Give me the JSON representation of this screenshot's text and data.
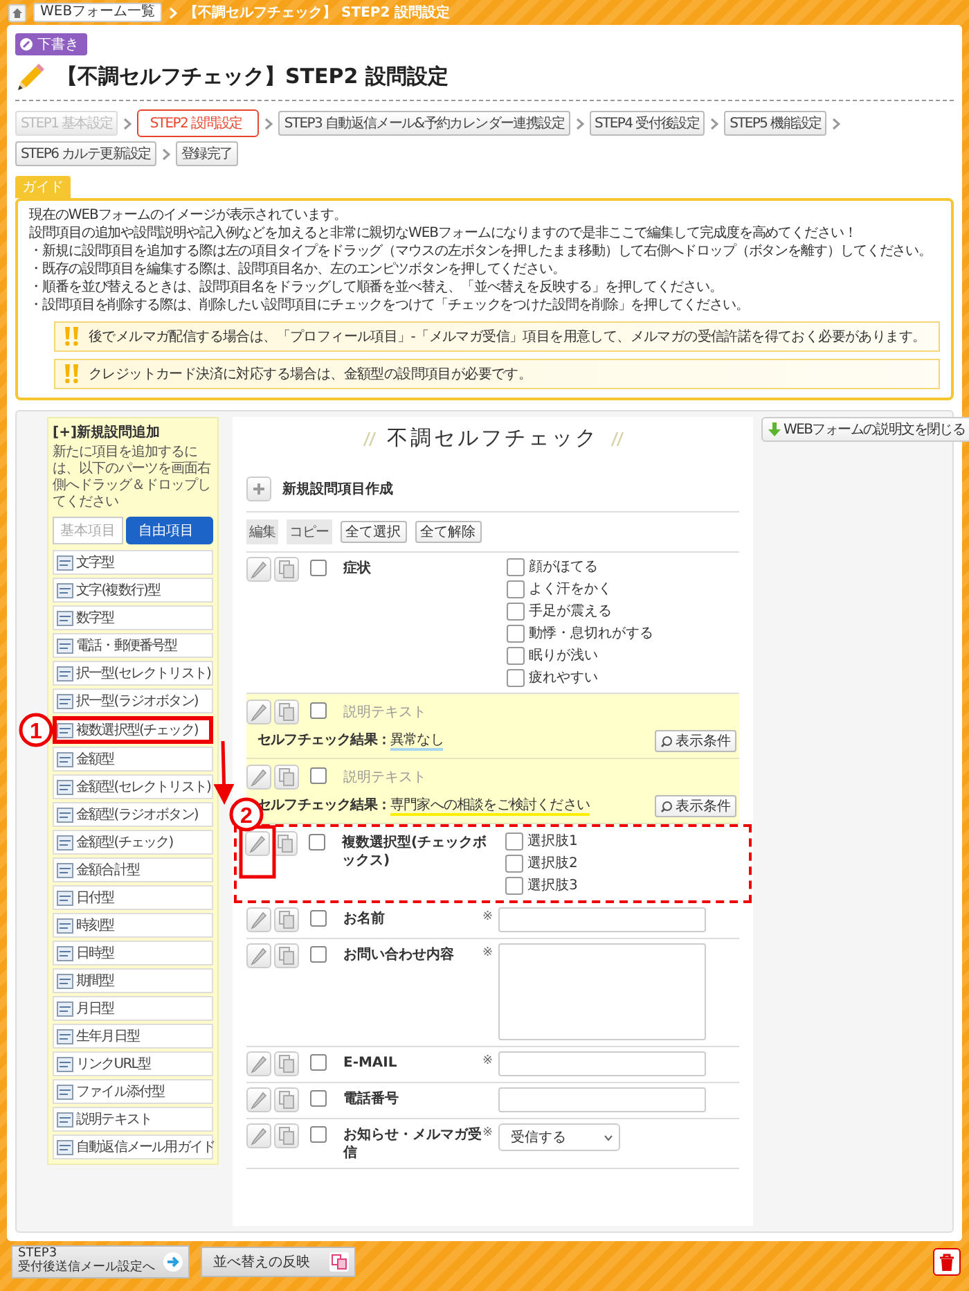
{
  "top_bar": {
    "breadcrumb": "WEBフォーム一覧",
    "title": "【不調セルフチェック】 STEP2 設問設定"
  },
  "status_badge": "下書き",
  "page_title": "【不調セルフチェック】STEP2 設問設定",
  "steps": [
    {
      "label": "STEP1 基本設定",
      "selected": false,
      "disabled": true
    },
    {
      "label": "STEP2 設問設定",
      "selected": true,
      "disabled": false
    },
    {
      "label": "STEP3 自動返信メール&予約カレンダー連携設定",
      "selected": false,
      "disabled": false
    },
    {
      "label": "STEP4 受付後設定",
      "selected": false,
      "disabled": false
    },
    {
      "label": "STEP5 機能設定",
      "selected": false,
      "disabled": false
    },
    {
      "label": "STEP6 カルテ更新設定",
      "selected": false,
      "disabled": false
    },
    {
      "label": "登録完了",
      "selected": false,
      "disabled": false
    }
  ],
  "guide": {
    "label": "ガイド",
    "lines": [
      "現在のWEBフォームのイメージが表示されています。",
      "設問項目の追加や設問説明や記入例などを加えると非常に親切なWEBフォームになりますので是非ここで編集して完成度を高めてください！",
      "・新規に設問項目を追加する際は左の項目タイプをドラッグ（マウスの左ボタンを押したまま移動）して右側へドロップ（ボタンを離す）してください。",
      "・既存の設問項目を編集する際は、設問項目名か、左のエンピツボタンを押してください。",
      "・順番を並び替えるときは、設問項目名をドラッグして順番を並べ替え、「並べ替えを反映する」を押してください。",
      "・設問項目を削除する際は、削除したい設問項目にチェックをつけて「チェックをつけた設問を削除」を押してください。"
    ],
    "notes": [
      "後でメルマガ配信する場合は、「プロフィール項目」-「メルマガ受信」項目を用意して、メルマガの受信許諾を得ておく必要があります。",
      "クレジットカード決済に対応する場合は、金額型の設問項目が必要です。"
    ]
  },
  "sidebar": {
    "title": "[+]新規設問追加",
    "description": "新たに項目を追加するには、以下のパーツを画面右側へドラッグ＆ドロップしてください",
    "tabs": [
      {
        "label": "基本項目",
        "selected": false
      },
      {
        "label": "自由項目",
        "selected": true
      }
    ],
    "items": [
      {
        "label": "文字型",
        "highlighted": false
      },
      {
        "label": "文字(複数行)型",
        "highlighted": false
      },
      {
        "label": "数字型",
        "highlighted": false
      },
      {
        "label": "電話・郵便番号型",
        "highlighted": false
      },
      {
        "label": "択一型(セレクトリスト)",
        "highlighted": false
      },
      {
        "label": "択一型(ラジオボタン)",
        "highlighted": false
      },
      {
        "label": "複数選択型(チェック)",
        "highlighted": true
      },
      {
        "label": "金額型",
        "highlighted": false
      },
      {
        "label": "金額型(セレクトリスト)",
        "highlighted": false
      },
      {
        "label": "金額型(ラジオボタン)",
        "highlighted": false
      },
      {
        "label": "金額型(チェック)",
        "highlighted": false
      },
      {
        "label": "金額合計型",
        "highlighted": false
      },
      {
        "label": "日付型",
        "highlighted": false
      },
      {
        "label": "時刻型",
        "highlighted": false
      },
      {
        "label": "日時型",
        "highlighted": false
      },
      {
        "label": "期間型",
        "highlighted": false
      },
      {
        "label": "月日型",
        "highlighted": false
      },
      {
        "label": "生年月日型",
        "highlighted": false
      },
      {
        "label": "リンクURL型",
        "highlighted": false
      },
      {
        "label": "ファイル添付型",
        "highlighted": false
      },
      {
        "label": "説明テキスト",
        "highlighted": false
      },
      {
        "label": "自動返信メール用ガイド",
        "highlighted": false
      }
    ]
  },
  "close_description_button": "WEBフォームの説明文を閉じる",
  "form": {
    "title": "不調セルフチェック",
    "new_item": "新規設問項目作成",
    "column_edit": "編集",
    "column_copy": "コピー",
    "select_all": "全て選択",
    "deselect_all": "全て解除",
    "rows": [
      {
        "kind": "checkboxes",
        "label": "症状",
        "checked": false,
        "highlighted": false,
        "options": [
          {
            "label": "顔がほてる",
            "checked": false
          },
          {
            "label": "よく汗をかく",
            "checked": false
          },
          {
            "label": "手足が震える",
            "checked": false
          },
          {
            "label": "動悸・息切れがする",
            "checked": false
          },
          {
            "label": "眠りが浅い",
            "checked": false
          },
          {
            "label": "疲れやすい",
            "checked": false
          }
        ]
      },
      {
        "kind": "description",
        "label": "説明テキスト",
        "checked": false,
        "highlighted": false,
        "result_label": "セルフチェック結果：",
        "result": "異常なし",
        "color": "#a9d5f0",
        "condition_button": "表示条件"
      },
      {
        "kind": "description",
        "label": "説明テキスト",
        "checked": false,
        "highlighted": false,
        "result_label": "セルフチェック結果：",
        "result": "専門家への相談をご検討ください",
        "color": "#ffee00",
        "condition_button": "表示条件"
      },
      {
        "kind": "checkboxes",
        "label": "複数選択型(チェックボックス)",
        "checked": false,
        "highlighted": true,
        "options": [
          {
            "label": "選択肢1",
            "checked": false
          },
          {
            "label": "選択肢2",
            "checked": false
          },
          {
            "label": "選択肢3",
            "checked": false
          }
        ]
      },
      {
        "kind": "text",
        "label": "お名前",
        "checked": false,
        "highlighted": false,
        "required_mark": "※"
      },
      {
        "kind": "textarea",
        "label": "お問い合わせ内容",
        "checked": false,
        "highlighted": false,
        "required_mark": "※"
      },
      {
        "kind": "text",
        "label": "E-MAIL",
        "checked": false,
        "highlighted": false,
        "required_mark": "※"
      },
      {
        "kind": "text",
        "label": "電話番号",
        "checked": false,
        "highlighted": false
      },
      {
        "kind": "select",
        "label": "お知らせ・メルマガ受信",
        "checked": false,
        "highlighted": false,
        "required_mark": "※",
        "value": "受信する"
      }
    ]
  },
  "callouts": [
    {
      "number": "1"
    },
    {
      "number": "2"
    }
  ],
  "bottom_bar": {
    "next_step": "STEP3",
    "next_label": "受付後送信メール設定へ",
    "apply_order": "並べ替えの反映"
  }
}
